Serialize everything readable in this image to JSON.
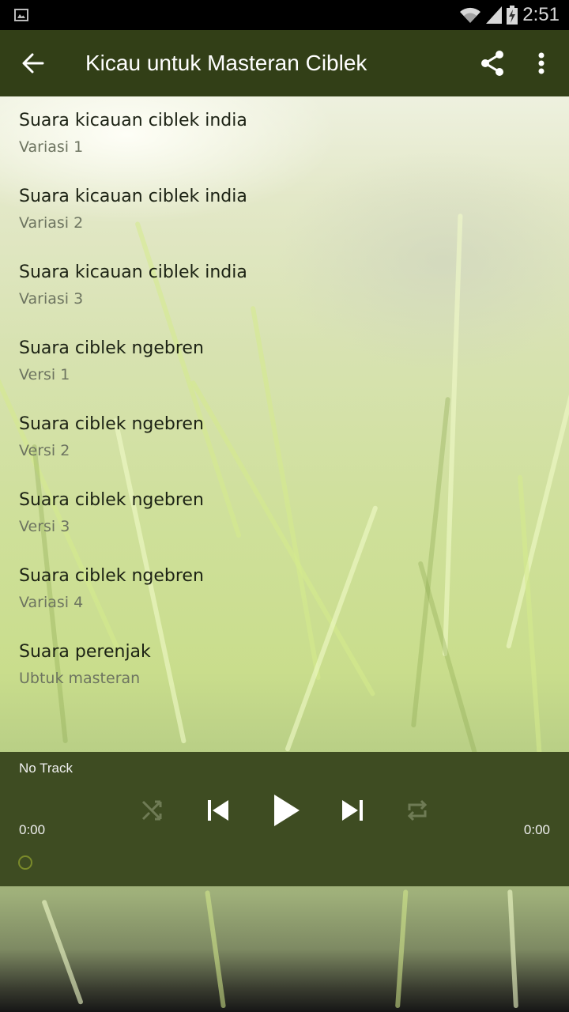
{
  "status_bar": {
    "time": "2:51",
    "icons": [
      "image-notification-icon",
      "wifi-icon",
      "signal-icon",
      "battery-charging-icon"
    ]
  },
  "app_bar": {
    "title": "Kicau untuk Masteran Ciblek",
    "back_icon": "arrow-back-icon",
    "actions": [
      "share-icon",
      "more-vert-icon"
    ],
    "color": "#323f17"
  },
  "tracks": [
    {
      "title": "Suara kicauan ciblek india",
      "subtitle": "Variasi 1"
    },
    {
      "title": "Suara kicauan ciblek india",
      "subtitle": "Variasi 2"
    },
    {
      "title": "Suara kicauan ciblek india",
      "subtitle": "Variasi 3"
    },
    {
      "title": "Suara ciblek ngebren",
      "subtitle": "Versi 1"
    },
    {
      "title": "Suara ciblek ngebren",
      "subtitle": "Versi 2"
    },
    {
      "title": "Suara ciblek ngebren",
      "subtitle": "Versi 3"
    },
    {
      "title": "Suara ciblek ngebren",
      "subtitle": "Variasi 4"
    },
    {
      "title": "Suara perenjak",
      "subtitle": "Ubtuk masteran"
    }
  ],
  "player": {
    "track_label": "No Track",
    "current_time": "0:00",
    "duration": "0:00",
    "progress": 0,
    "controls": [
      "shuffle-icon",
      "skip-previous-icon",
      "play-icon",
      "skip-next-icon",
      "repeat-icon"
    ],
    "shuffle_enabled": false,
    "repeat_enabled": false,
    "color": "#3e4c22",
    "seek_color": "#7a8a2a"
  }
}
